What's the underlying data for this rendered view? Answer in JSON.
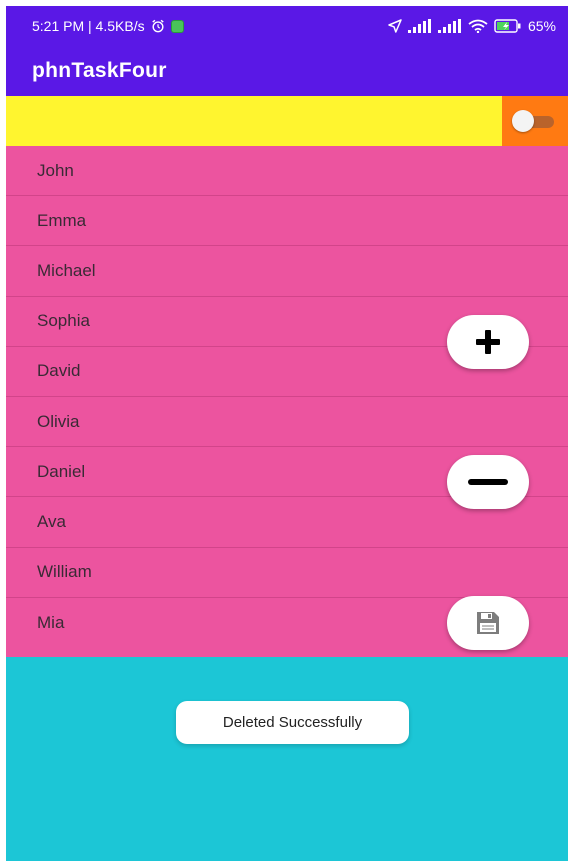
{
  "status_bar": {
    "time_speed": "5:21 PM | 4.5KB/s",
    "battery": "65%",
    "icons": [
      "alarm-icon",
      "notification-icon",
      "location-icon",
      "signal-icon",
      "signal-icon",
      "wifi-icon",
      "battery-icon"
    ]
  },
  "app_bar": {
    "title": "phnTaskFour"
  },
  "colors": {
    "app_bar": "#5a18e6",
    "yellow_bar": "#fff52f",
    "toggle_box": "#ff7a12",
    "list_bg": "#ec549f",
    "bottom_bg": "#1cc6d6"
  },
  "toggle": {
    "state": "off"
  },
  "list": {
    "items": [
      "John",
      "Emma",
      "Michael",
      "Sophia",
      "David",
      "Olivia",
      "Daniel",
      "Ava",
      "William",
      "Mia"
    ]
  },
  "fabs": {
    "add_icon": "plus-icon",
    "remove_icon": "minus-icon",
    "save_icon": "floppy-disk-icon"
  },
  "toast": {
    "message": "Deleted Successfully"
  }
}
